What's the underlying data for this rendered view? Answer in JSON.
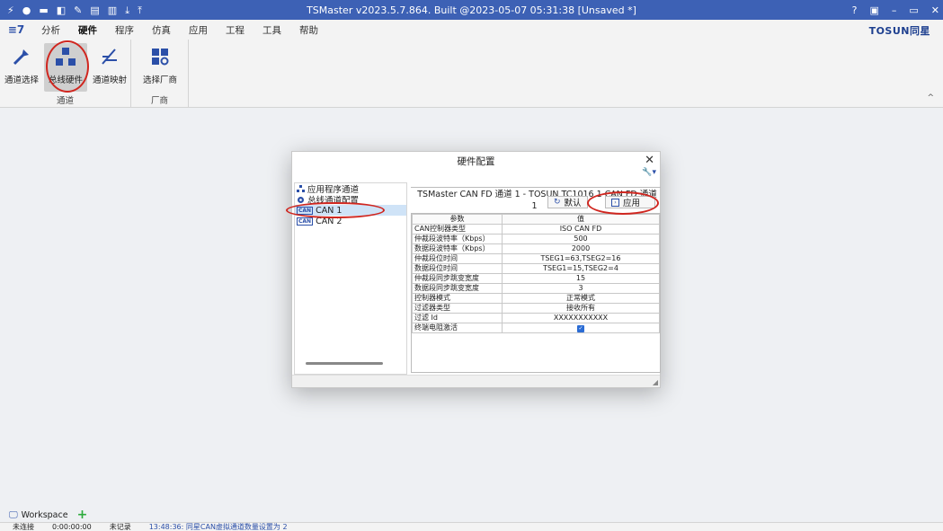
{
  "titlebar": {
    "title": "TSMaster v2023.5.7.864. Built @2023-05-07 05:31:38 [Unsaved *]",
    "quick_access": [
      "⚡",
      "●",
      "▬",
      "◧",
      "✎",
      "▤",
      "▥",
      "⤓",
      "⤒"
    ],
    "window_controls": [
      "?",
      "▣",
      "–",
      "▭",
      "✕"
    ]
  },
  "menubar": {
    "logo": "≡7",
    "items": [
      "分析",
      "硬件",
      "程序",
      "仿真",
      "应用",
      "工程",
      "工具",
      "帮助"
    ],
    "active_index": 1,
    "brand": "TOSUN同星"
  },
  "ribbon": {
    "groups": [
      {
        "label": "通道",
        "buttons": [
          {
            "label": "通道选择"
          },
          {
            "label": "总线硬件"
          },
          {
            "label": "通道映射"
          }
        ]
      },
      {
        "label": "厂商",
        "buttons": [
          {
            "label": "选择厂商"
          }
        ]
      }
    ],
    "collapse_glyph": "^"
  },
  "dialog": {
    "title": "硬件配置",
    "close": "✕",
    "wrench": "🔧▾",
    "tree": [
      {
        "label": "应用程序通道",
        "icon": "app-channel-icon"
      },
      {
        "label": "总线通道配置",
        "icon": "bus-config-icon"
      },
      {
        "label": "CAN 1",
        "tag": "CAN",
        "selected": true
      },
      {
        "label": "CAN 2",
        "tag": "CAN"
      }
    ],
    "group_title": "TSMaster CAN FD 通道 1 - TOSUN TC1016 1 CAN FD 通道 1",
    "default_btn": "默认",
    "apply_btn": "应用",
    "grid": {
      "headers": [
        "参数",
        "值"
      ],
      "rows": [
        {
          "param": "CAN控制器类型",
          "value": "ISO CAN FD"
        },
        {
          "param": "仲裁段波特率（Kbps）",
          "value": "500"
        },
        {
          "param": "数据段波特率（Kbps）",
          "value": "2000"
        },
        {
          "param": "仲裁段位时间",
          "value": "TSEG1=63,TSEG2=16"
        },
        {
          "param": "数据段位时间",
          "value": "TSEG1=15,TSEG2=4"
        },
        {
          "param": "仲裁段同步跳变宽度",
          "value": "15"
        },
        {
          "param": "数据段同步跳变宽度",
          "value": "3"
        },
        {
          "param": "控制器模式",
          "value": "正常模式"
        },
        {
          "param": "过滤器类型",
          "value": "接收所有"
        },
        {
          "param": "过滤 Id",
          "value": "XXXXXXXXXXX"
        },
        {
          "param": "终端电阻激活",
          "value": "",
          "checkbox": true
        }
      ]
    }
  },
  "bottom": {
    "workspace_tab": "Workspace",
    "status": {
      "connection": "未连接",
      "time": "0:00:00:00",
      "record": "未记录",
      "message": "13:48:36: 同星CAN虚拟通道数量设置为 2"
    }
  },
  "colors": {
    "titlebar": "#3d61b5",
    "accent": "#2b4fa8",
    "annotation": "#d0261f"
  }
}
